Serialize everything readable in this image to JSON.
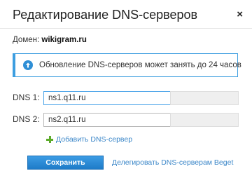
{
  "dialog": {
    "title": "Редактирование DNS-серверов",
    "close_glyph": "×"
  },
  "domain": {
    "label": "Домен:",
    "value": "wikigram.ru"
  },
  "notice": {
    "icon": "upload-circle-icon",
    "text": "Обновление DNS-серверов может занять до 24 часов",
    "accent_color": "#3d9ee0"
  },
  "dns": [
    {
      "label": "DNS 1:",
      "value": "ns1.q11.ru",
      "ip": ""
    },
    {
      "label": "DNS 2:",
      "value": "ns2.q11.ru",
      "ip": ""
    }
  ],
  "actions": {
    "add_label": "Добавить DNS-сервер",
    "save_label": "Сохранить",
    "delegate_label": "Делегировать DNS-серверам Beget"
  }
}
